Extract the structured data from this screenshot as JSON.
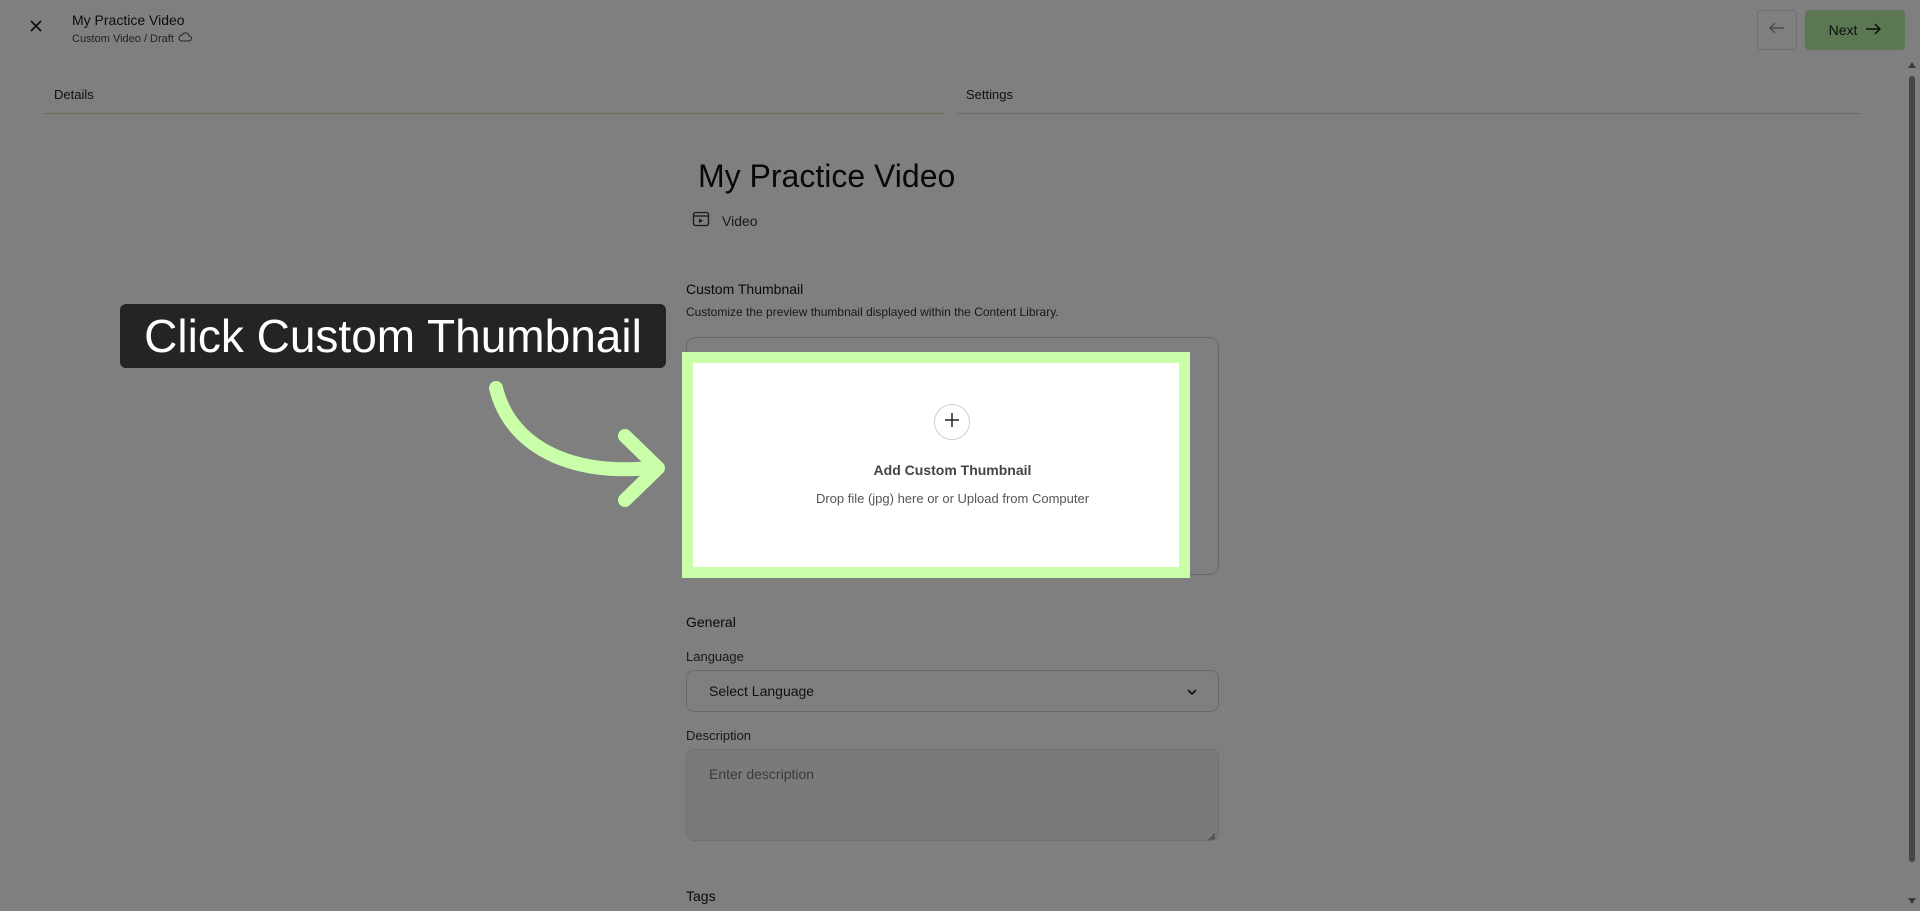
{
  "header": {
    "title": "My Practice Video",
    "breadcrumb": "Custom Video / Draft",
    "next_label": "Next"
  },
  "tabs": [
    {
      "label": "Details",
      "active": true
    },
    {
      "label": "Settings",
      "active": false
    }
  ],
  "main": {
    "title": "My Practice Video",
    "type_label": "Video"
  },
  "thumbnail": {
    "section_label": "Custom Thumbnail",
    "section_desc": "Customize the preview thumbnail displayed within the Content Library.",
    "title": "Add Custom Thumbnail",
    "subtitle": "Drop file (jpg) here or or Upload from Computer"
  },
  "general": {
    "section_label": "General",
    "language_label": "Language",
    "language_value": "Select Language",
    "description_label": "Description",
    "description_placeholder": "Enter description"
  },
  "tags": {
    "section_label": "Tags"
  },
  "callout": {
    "text": "Click Custom Thumbnail"
  },
  "colors": {
    "accent": "#c8ffa8",
    "next_button": "#b9f1a4",
    "overlay": "rgba(0,0,0,0.5)",
    "callout_bg": "#242424"
  }
}
